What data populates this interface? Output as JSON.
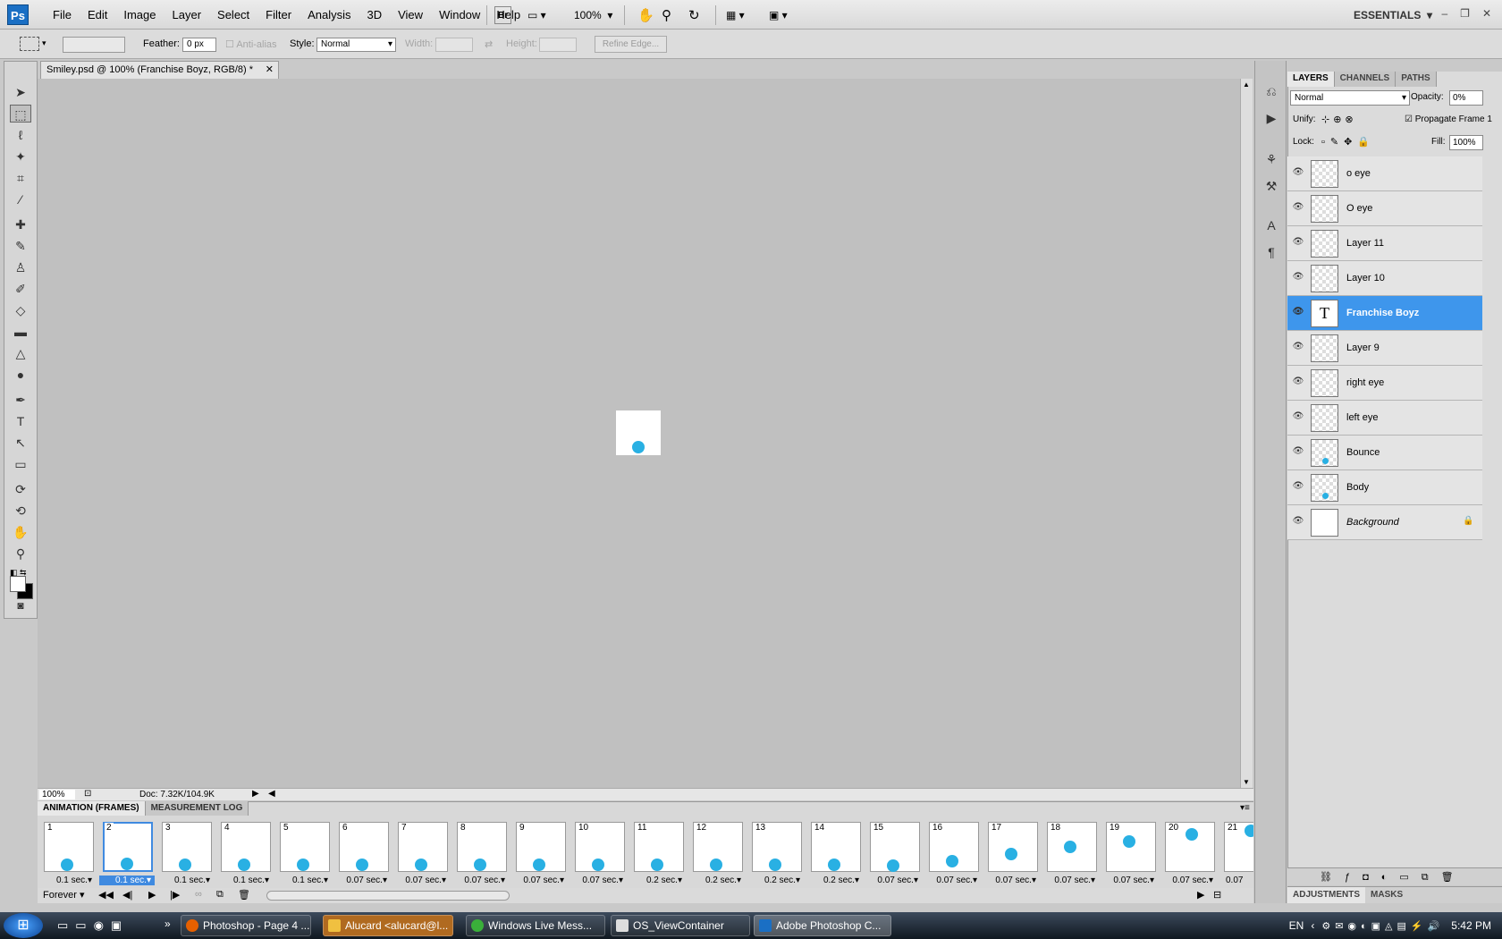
{
  "menubar": {
    "menus": [
      "File",
      "Edit",
      "Image",
      "Layer",
      "Select",
      "Filter",
      "Analysis",
      "3D",
      "View",
      "Window",
      "Help"
    ],
    "bridge": "Br",
    "zoom": "100%",
    "workspace": "ESSENTIALS"
  },
  "options": {
    "feather_label": "Feather:",
    "feather_value": "0 px",
    "antialias": "Anti-alias",
    "style_label": "Style:",
    "style_value": "Normal",
    "width_label": "Width:",
    "height_label": "Height:",
    "refine_edge": "Refine Edge..."
  },
  "document": {
    "tab_title": "Smiley.psd @ 100% (Franchise  Boyz, RGB/8) *",
    "zoom": "100%",
    "doc_info": "Doc: 7.32K/104.9K"
  },
  "animation": {
    "tabs": [
      "ANIMATION (FRAMES)",
      "MEASUREMENT LOG"
    ],
    "frames": [
      {
        "num": "1",
        "delay": "0.1 sec."
      },
      {
        "num": "2",
        "delay": "0.1 sec."
      },
      {
        "num": "3",
        "delay": "0.1 sec."
      },
      {
        "num": "4",
        "delay": "0.1 sec."
      },
      {
        "num": "5",
        "delay": "0.1 sec."
      },
      {
        "num": "6",
        "delay": "0.07 sec."
      },
      {
        "num": "7",
        "delay": "0.07 sec."
      },
      {
        "num": "8",
        "delay": "0.07 sec."
      },
      {
        "num": "9",
        "delay": "0.07 sec."
      },
      {
        "num": "10",
        "delay": "0.07 sec."
      },
      {
        "num": "11",
        "delay": "0.2 sec."
      },
      {
        "num": "12",
        "delay": "0.2 sec."
      },
      {
        "num": "13",
        "delay": "0.2 sec."
      },
      {
        "num": "14",
        "delay": "0.2 sec."
      },
      {
        "num": "15",
        "delay": "0.07 sec."
      },
      {
        "num": "16",
        "delay": "0.07 sec."
      },
      {
        "num": "17",
        "delay": "0.07 sec."
      },
      {
        "num": "18",
        "delay": "0.07 sec."
      },
      {
        "num": "19",
        "delay": "0.07 sec."
      },
      {
        "num": "20",
        "delay": "0.07 sec."
      },
      {
        "num": "21",
        "delay": "0.07"
      }
    ],
    "loop": "Forever"
  },
  "layers_panel": {
    "tabs": [
      "LAYERS",
      "CHANNELS",
      "PATHS"
    ],
    "blend_mode": "Normal",
    "opacity_label": "Opacity:",
    "opacity_value": "0%",
    "unify_label": "Unify:",
    "propagate": "Propagate Frame 1",
    "lock_label": "Lock:",
    "fill_label": "Fill:",
    "fill_value": "100%",
    "layers": [
      {
        "name": "o eye"
      },
      {
        "name": "O eye"
      },
      {
        "name": "Layer 11"
      },
      {
        "name": "Layer 10"
      },
      {
        "name": "Franchise  Boyz"
      },
      {
        "name": "Layer 9"
      },
      {
        "name": "right eye"
      },
      {
        "name": "left eye"
      },
      {
        "name": "Bounce"
      },
      {
        "name": "Body"
      },
      {
        "name": "Background"
      }
    ],
    "bottom_tabs": [
      "ADJUSTMENTS",
      "MASKS"
    ]
  },
  "taskbar": {
    "buttons": [
      "Photoshop - Page 4 ...",
      "Alucard <alucard@l...",
      "Windows Live Mess...",
      "OS_ViewContainer",
      "Adobe Photoshop C..."
    ],
    "lang": "EN",
    "time": "5:42 PM"
  },
  "colors": {
    "accent": "#3e96ec",
    "ball": "#29b0e3"
  }
}
